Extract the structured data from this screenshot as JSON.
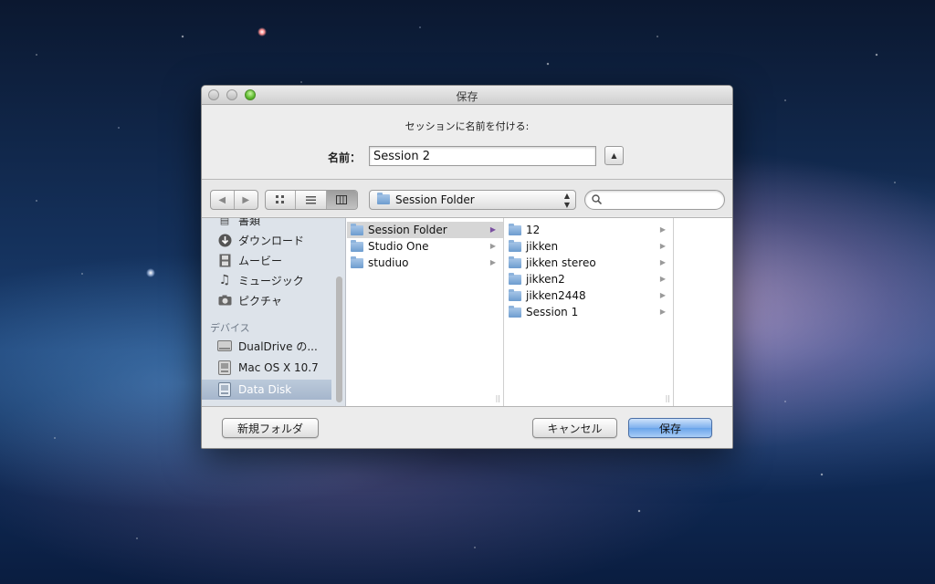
{
  "dialog": {
    "title": "保存",
    "prompt": "セッションに名前を付ける:",
    "name_label": "名前：",
    "name_value": "Session 2",
    "expand_glyph": "▲"
  },
  "toolbar": {
    "back_glyph": "◀",
    "forward_glyph": "▶",
    "location": "Session Folder",
    "search_placeholder": "",
    "active_view": "columns"
  },
  "sidebar": {
    "items_top": [
      {
        "label": "書類",
        "icon": "document-icon"
      },
      {
        "label": "ダウンロード",
        "icon": "download-icon"
      },
      {
        "label": "ムービー",
        "icon": "movie-icon"
      },
      {
        "label": "ミュージック",
        "icon": "music-icon"
      },
      {
        "label": "ピクチャ",
        "icon": "camera-icon"
      }
    ],
    "devices_header": "デバイス",
    "devices": [
      {
        "label": "DualDrive の...",
        "icon": "drive-icon"
      },
      {
        "label": "Mac OS X 10.7",
        "icon": "drive-icon"
      },
      {
        "label": "Data Disk",
        "icon": "drive-icon",
        "selected": true
      }
    ]
  },
  "columns": {
    "col1": [
      {
        "label": "Session Folder",
        "selected": true
      },
      {
        "label": "Studio One"
      },
      {
        "label": "studiuo"
      }
    ],
    "col2": [
      {
        "label": "12"
      },
      {
        "label": "jikken"
      },
      {
        "label": "jikken stereo"
      },
      {
        "label": "jikken2"
      },
      {
        "label": "jikken2448"
      },
      {
        "label": "Session 1"
      }
    ]
  },
  "buttons": {
    "new_folder": "新規フォルダ",
    "cancel": "キャンセル",
    "save": "保存"
  },
  "colors": {
    "selection_highlight": "#d6d6d6",
    "default_button": "#6aa4ea",
    "sidebar_bg": "#dde3ea"
  }
}
